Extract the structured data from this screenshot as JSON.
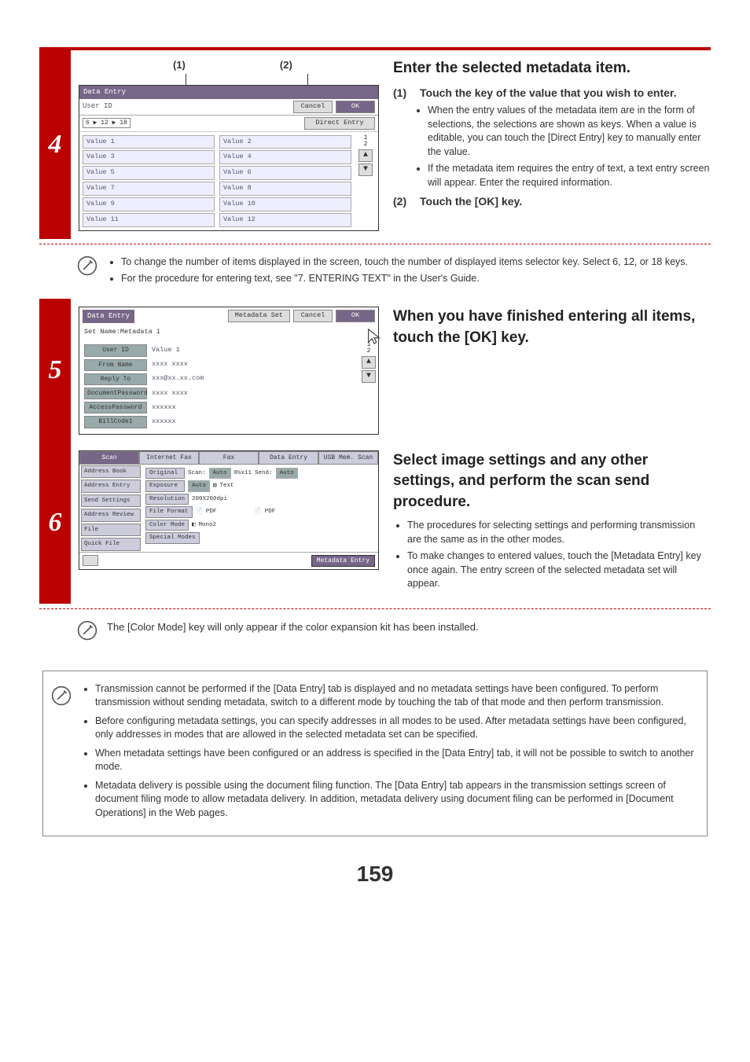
{
  "step4": {
    "callout1": "(1)",
    "callout2": "(2)",
    "panel": {
      "title": "Data Entry",
      "userId": "User ID",
      "cancel": "Cancel",
      "ok": "OK",
      "selector": "6 ▶ 12 ▶ 18",
      "directEntry": "Direct Entry",
      "values": [
        "Value 1",
        "Value 2",
        "Value 3",
        "Value 4",
        "Value 5",
        "Value 6",
        "Value 7",
        "Value 8",
        "Value 9",
        "Value 10",
        "Value 11",
        "Value 12"
      ],
      "page": "1",
      "pages": "2"
    },
    "heading": "Enter the selected metadata item.",
    "s1_idx": "(1)",
    "s1_head": "Touch the key of the value that you wish to enter.",
    "s1_b1": "When the entry values of the metadata item are in the form of selections, the selections are shown as keys. When a value is editable, you can touch the [Direct Entry] key to manually enter the value.",
    "s1_b2": "If the metadata item requires the entry of text, a text entry screen will appear. Enter the required information.",
    "s2_idx": "(2)",
    "s2_head": "Touch the [OK] key.",
    "note_b1": "To change the number of items displayed in the screen, touch the number of displayed items selector key. Select 6, 12, or 18 keys.",
    "note_b2": "For the procedure for entering text, see \"7. ENTERING TEXT\" in the User's Guide."
  },
  "step5": {
    "panel": {
      "title": "Data Entry",
      "metaset": "Metadata Set",
      "cancel": "Cancel",
      "ok": "OK",
      "setName": "Set Name:Metadata 1",
      "rows": [
        {
          "k": "User ID",
          "v": "Value 1"
        },
        {
          "k": "From Name",
          "v": "xxxx xxxx"
        },
        {
          "k": "Reply To",
          "v": "xxx@xx.xx.com"
        },
        {
          "k": "DocumentPassword",
          "v": "xxxx xxxx"
        },
        {
          "k": "AccessPassword",
          "v": "xxxxxx"
        },
        {
          "k": "BillCode1",
          "v": "xxxxxx"
        }
      ],
      "page": "1",
      "pages": "2"
    },
    "heading": "When you have finished entering all items, touch the [OK] key."
  },
  "step6": {
    "panel": {
      "tabs": [
        "Scan",
        "Internet Fax",
        "Fax",
        "Data Entry",
        "USB Mem. Scan"
      ],
      "side": [
        "Address Book",
        "Address Entry",
        "Send Settings",
        "Address Review",
        "File",
        "Quick File"
      ],
      "original": "Original",
      "scan": "Scan:",
      "auto": "Auto",
      "size": "8½x11",
      "send": "Send:",
      "autob": "Auto",
      "exposure": "Exposure",
      "expv": "Auto",
      "text": "Text",
      "resolution": "Resolution",
      "resv": "200X200dpi",
      "fileformat": "File Format",
      "pdf": "PDF",
      "pdf2": "PDF",
      "colormode": "Color Mode",
      "mono": "Mono2",
      "special": "Special Modes",
      "metaentry": "Metadata Entry"
    },
    "heading": "Select image settings and any other settings, and perform the scan send procedure.",
    "b1": "The procedures for selecting settings and performing transmission are the same as in the other modes.",
    "b2": "To make changes to entered values, touch the [Metadata Entry] key once again. The entry screen of the selected metadata set will appear.",
    "note": "The [Color Mode] key will only appear if the color expansion kit has been installed."
  },
  "finalnote": {
    "b1": "Transmission cannot be performed if the [Data Entry] tab is displayed and no metadata settings have been configured. To perform transmission without sending metadata, switch to a different mode by touching the tab of that mode and then perform transmission.",
    "b2": "Before configuring metadata settings, you can specify addresses in all modes to be used. After metadata settings have been configured, only addresses in modes that are allowed in the selected metadata set can be specified.",
    "b3": "When metadata settings have been configured or an address is specified in the [Data Entry] tab, it will not be possible to switch to another mode.",
    "b4": "Metadata delivery is possible using the document filing function. The [Data Entry] tab appears in the transmission settings screen of document filing mode to allow metadata delivery. In addition, metadata delivery using document filing can be performed in [Document Operations] in the Web pages."
  },
  "pageNumber": "159"
}
